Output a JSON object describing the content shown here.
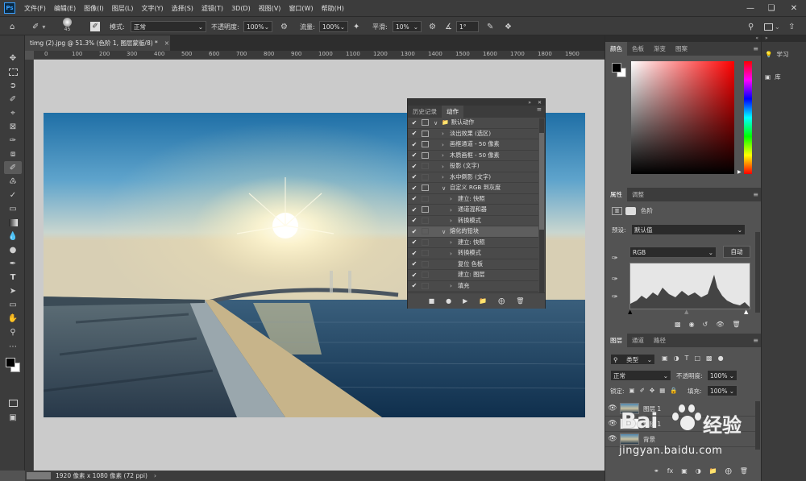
{
  "app": {
    "logo_text": "Ps"
  },
  "menubar": {
    "items": [
      "文件(F)",
      "编辑(E)",
      "图像(I)",
      "图层(L)",
      "文字(Y)",
      "选择(S)",
      "滤镜(T)",
      "3D(D)",
      "视图(V)",
      "窗口(W)",
      "帮助(H)"
    ]
  },
  "options": {
    "brush_size": "45",
    "mode_label": "模式:",
    "mode_value": "正常",
    "opacity_label": "不透明度:",
    "opacity_value": "100%",
    "flow_label": "流量:",
    "flow_value": "100%",
    "smooth_label": "平滑:",
    "smooth_value": "10%",
    "angle_value": "1°"
  },
  "document": {
    "tab_title": "timg (2).jpg @ 51.3% (色阶 1, 图层蒙版/8) *",
    "status_text": "1920 像素 x 1080 像素 (72 ppi)"
  },
  "ruler": {
    "ticks": [
      "0",
      "100",
      "200",
      "300",
      "400",
      "500",
      "600",
      "700",
      "800",
      "900",
      "1000",
      "1100",
      "1200",
      "1300",
      "1400",
      "1500",
      "1600",
      "1700",
      "1800",
      "1900"
    ]
  },
  "actions_panel": {
    "tabs": [
      "历史记录",
      "动作"
    ],
    "rows": [
      {
        "label": "默认动作",
        "type": "set",
        "dialog": true,
        "indent": 0,
        "arrow": "v"
      },
      {
        "label": "淡出效果 (选区)",
        "dialog": true,
        "indent": 1,
        "arrow": ">"
      },
      {
        "label": "画框通道 - 50 像素",
        "dialog": true,
        "indent": 1,
        "arrow": ">"
      },
      {
        "label": "木质画框 - 50 像素",
        "dialog": true,
        "indent": 1,
        "arrow": ">"
      },
      {
        "label": "投影 (文字)",
        "dialog": false,
        "indent": 1,
        "arrow": ">"
      },
      {
        "label": "水中倒影 (文字)",
        "dialog": false,
        "indent": 1,
        "arrow": ">"
      },
      {
        "label": "自定义 RGB 到灰度",
        "dialog": true,
        "indent": 1,
        "arrow": "v"
      },
      {
        "label": "建立: 快照",
        "dialog": false,
        "indent": 2,
        "arrow": ">"
      },
      {
        "label": "通道混和器",
        "dialog": true,
        "indent": 2,
        "arrow": ">"
      },
      {
        "label": "转换模式",
        "dialog": false,
        "indent": 2,
        "arrow": ">"
      },
      {
        "label": "熔化的铅块",
        "dialog": false,
        "indent": 1,
        "arrow": "v",
        "selected": true
      },
      {
        "label": "建立: 快照",
        "dialog": false,
        "indent": 2,
        "arrow": ">"
      },
      {
        "label": "转换模式",
        "dialog": false,
        "indent": 2,
        "arrow": ">"
      },
      {
        "label": "复位 色板",
        "dialog": false,
        "indent": 2,
        "arrow": ""
      },
      {
        "label": "建立: 图层",
        "dialog": false,
        "indent": 2,
        "arrow": ""
      },
      {
        "label": "填充",
        "dialog": false,
        "indent": 2,
        "arrow": ">"
      }
    ]
  },
  "color_panel": {
    "tabs": [
      "颜色",
      "色板",
      "渐变",
      "图案"
    ],
    "foreground": "#000000",
    "background": "#ffffff"
  },
  "properties_panel": {
    "tabs": [
      "属性",
      "调整"
    ],
    "adj_name": "色阶",
    "preset_label": "预设:",
    "preset_value": "默认值",
    "channel_value": "RGB",
    "auto_button": "自动"
  },
  "layers_panel": {
    "tabs": [
      "图层",
      "通道",
      "路径"
    ],
    "filter_value": "类型",
    "blend_mode": "正常",
    "opacity_label": "不透明度:",
    "opacity_value": "100%",
    "lock_label": "锁定:",
    "fill_label": "填充:",
    "fill_value": "100%",
    "layers": [
      {
        "name": "图层 1"
      },
      {
        "name": "色阶 1"
      },
      {
        "name": "背景"
      }
    ]
  },
  "far_panel": {
    "items": [
      "学习",
      "库"
    ]
  },
  "watermark": {
    "brand_text": "Bai",
    "brand_cn": "经验",
    "url": "jingyan.baidu.com"
  }
}
